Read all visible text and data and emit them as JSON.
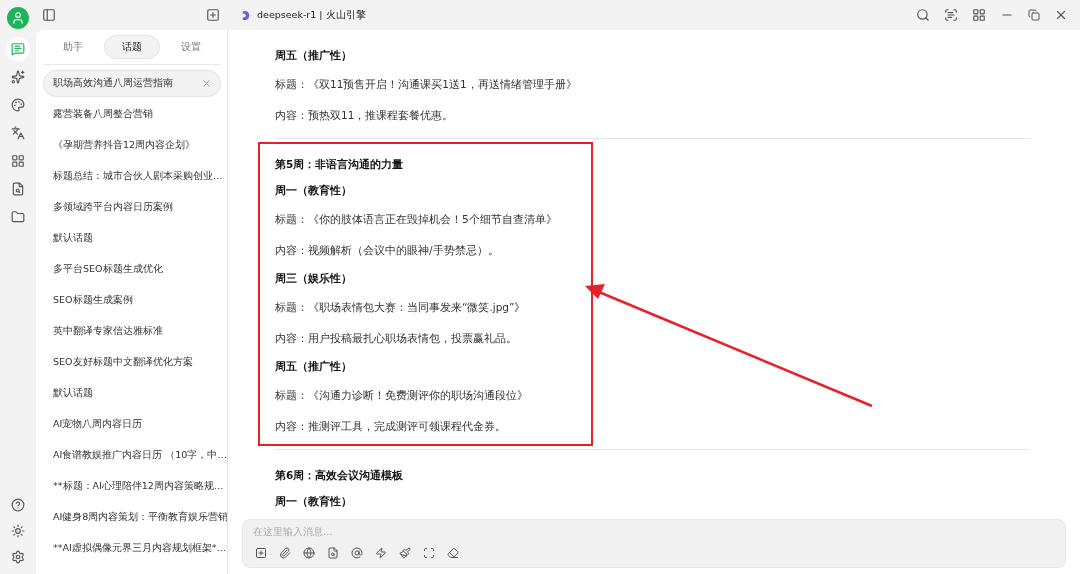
{
  "window": {
    "title": "deepseek-r1 | 火山引擎"
  },
  "rail": {
    "items": [
      {
        "kind": "chat",
        "selected": true
      },
      {
        "kind": "sparkle",
        "selected": false
      },
      {
        "kind": "palette",
        "selected": false
      },
      {
        "kind": "translate",
        "selected": false
      },
      {
        "kind": "apps",
        "selected": false
      },
      {
        "kind": "file",
        "selected": false
      },
      {
        "kind": "folder",
        "selected": false
      }
    ]
  },
  "sidebar": {
    "tabs": [
      {
        "label": "助手",
        "selected": false
      },
      {
        "label": "话题",
        "selected": true
      },
      {
        "label": "设置",
        "selected": false
      }
    ],
    "topics": [
      {
        "label": "职场高效沟通八周运营指南",
        "selected": true
      },
      {
        "label": "露营装备八周整合营销",
        "selected": false
      },
      {
        "label": "《孕期营养抖音12周内容企划》",
        "selected": false
      },
      {
        "label": "标题总结：城市合伙人剧本采购创业…",
        "selected": false
      },
      {
        "label": "多领域跨平台内容日历案例",
        "selected": false
      },
      {
        "label": "默认话题",
        "selected": false
      },
      {
        "label": "多平台SEO标题生成优化",
        "selected": false
      },
      {
        "label": "SEO标题生成案例",
        "selected": false
      },
      {
        "label": "英中翻译专家信达雅标准",
        "selected": false
      },
      {
        "label": "SEO友好标题中文翻译优化方案",
        "selected": false
      },
      {
        "label": "默认话题",
        "selected": false
      },
      {
        "label": "AI宠物八周内容日历",
        "selected": false
      },
      {
        "label": "AI食谱教娱推广内容日历 （10字，中…",
        "selected": false
      },
      {
        "label": "**标题：AI心理陪伴12周内容策略规…",
        "selected": false
      },
      {
        "label": "AI健身8周内容策划：平衡教育娱乐营销",
        "selected": false
      },
      {
        "label": "**AI虚拟偶像元界三月内容规划框架*…",
        "selected": false
      }
    ]
  },
  "content": {
    "sections": [
      {
        "highlighted": false,
        "lines": [
          {
            "kind": "heading",
            "text": "周五（推广性）"
          },
          {
            "kind": "text",
            "text": "标题：《双11预售开启！沟通课买1送1，再送情绪管理手册》"
          },
          {
            "kind": "text",
            "text": "内容：预热双11，推课程套餐优惠。"
          }
        ]
      },
      {
        "highlighted": true,
        "lines": [
          {
            "kind": "heading",
            "text": "第5周：非语言沟通的力量"
          },
          {
            "kind": "heading",
            "text": "周一（教育性）"
          },
          {
            "kind": "text",
            "text": "标题：《你的肢体语言正在毁掉机会！5个细节自查清单》"
          },
          {
            "kind": "text",
            "text": "内容：视频解析（会议中的眼神/手势禁忌）。"
          },
          {
            "kind": "heading",
            "text": "周三（娱乐性）"
          },
          {
            "kind": "text",
            "text": "标题：《职场表情包大赛：当同事发来“微笑.jpg”》"
          },
          {
            "kind": "text",
            "text": "内容：用户投稿最扎心职场表情包，投票赢礼品。"
          },
          {
            "kind": "heading",
            "text": "周五（推广性）"
          },
          {
            "kind": "text",
            "text": "标题：《沟通力诊断！免费测评你的职场沟通段位》"
          },
          {
            "kind": "text",
            "text": "内容：推测评工具，完成测评可领课程代金券。"
          }
        ]
      },
      {
        "highlighted": false,
        "lines": [
          {
            "kind": "heading",
            "text": "第6周：高效会议沟通模板"
          },
          {
            "kind": "heading",
            "text": "周一（教育性）"
          }
        ]
      }
    ]
  },
  "composer": {
    "placeholder": "在这里输入消息..."
  }
}
